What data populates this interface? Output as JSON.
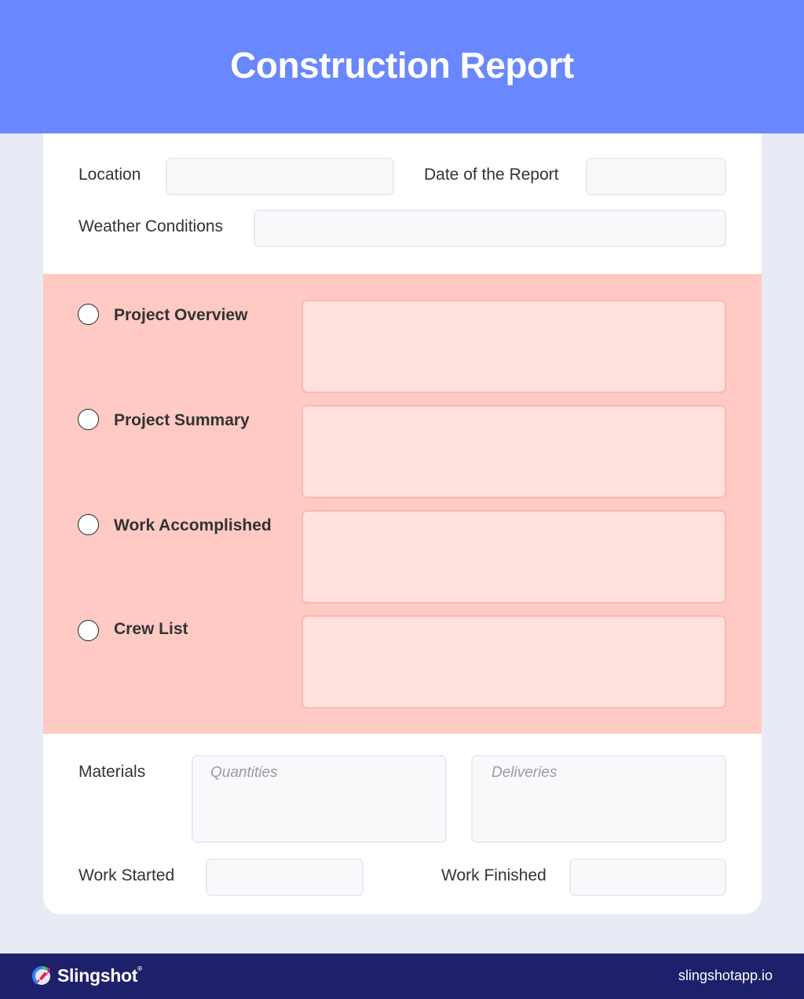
{
  "header": {
    "title": "Construction Report"
  },
  "general": {
    "location_label": "Location",
    "location_value": "",
    "date_label": "Date of the Report",
    "date_value": "",
    "weather_label": "Weather Conditions",
    "weather_value": ""
  },
  "sections": [
    {
      "label": "Project Overview",
      "checked": false,
      "value": ""
    },
    {
      "label": "Project Summary",
      "checked": false,
      "value": ""
    },
    {
      "label": "Work Accomplished",
      "checked": false,
      "value": ""
    },
    {
      "label": "Crew List",
      "checked": false,
      "value": ""
    }
  ],
  "materials": {
    "label": "Materials",
    "quantities_placeholder": "Quantities",
    "deliveries_placeholder": "Deliveries"
  },
  "work_times": {
    "started_label": "Work Started",
    "started_value": "",
    "finished_label": "Work Finished",
    "finished_value": ""
  },
  "footer": {
    "brand": "Slingshot",
    "brand_mark": "®",
    "website": "slingshotapp.io"
  },
  "colors": {
    "header_bg": "#6987ff",
    "page_bg": "#e8eaf6",
    "section_bg": "#ffcac4",
    "section_field_bg": "#ffe1de",
    "footer_bg": "#1f206b"
  }
}
